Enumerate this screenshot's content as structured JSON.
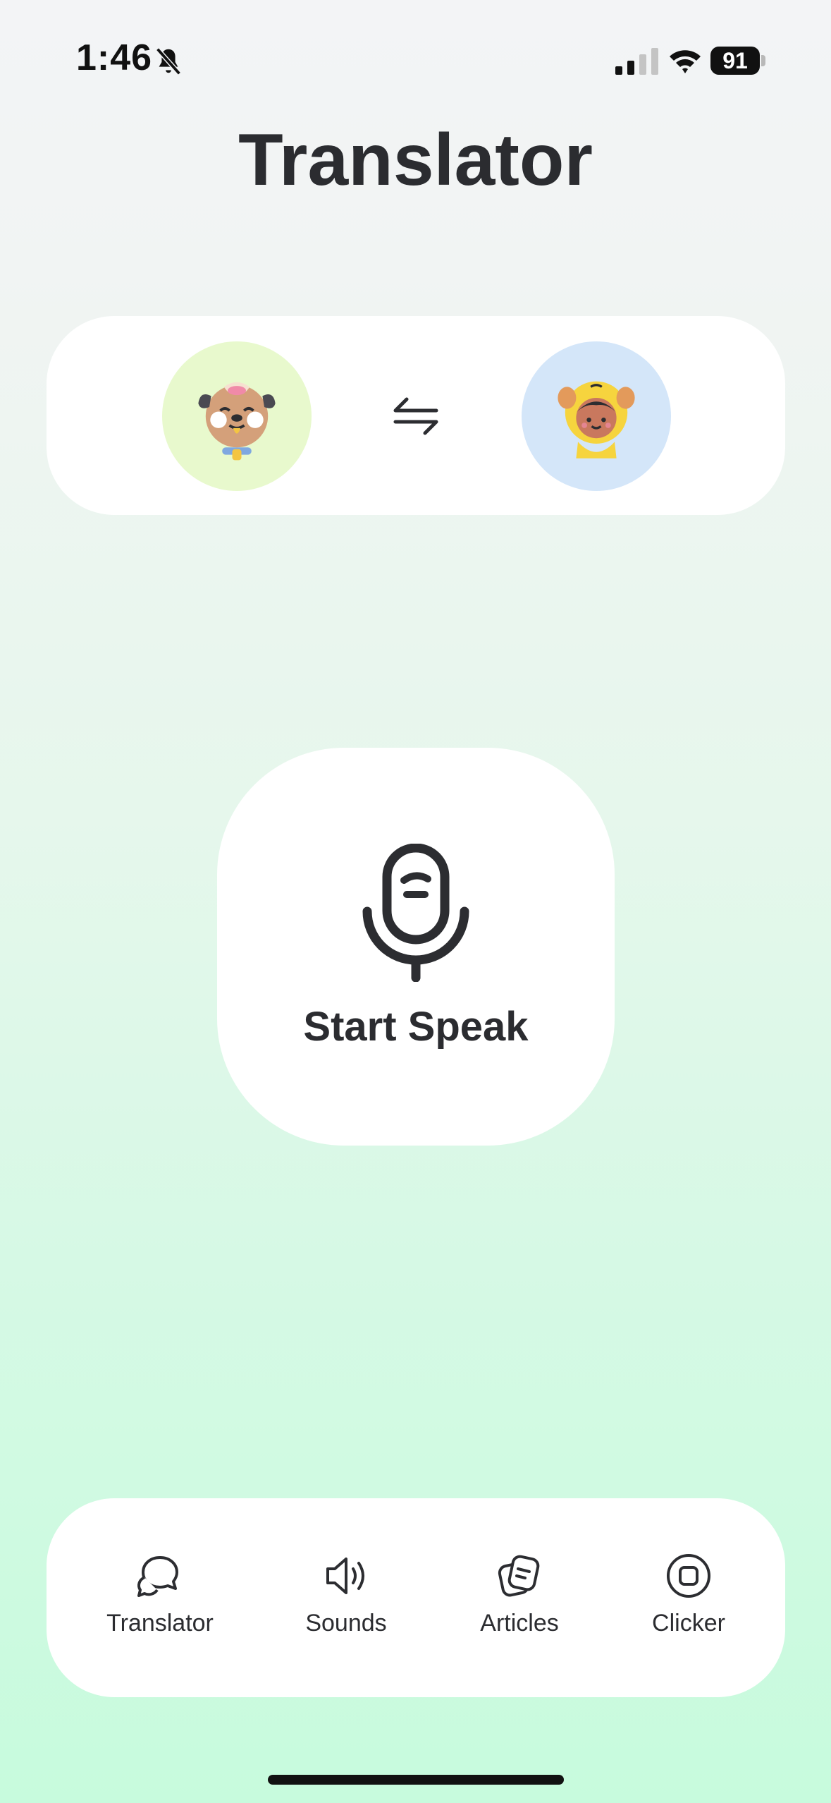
{
  "status_bar": {
    "time": "1:46",
    "battery": "91"
  },
  "header": {
    "title": "Translator"
  },
  "languages": {
    "from": "dog",
    "to": "human"
  },
  "speak": {
    "label": "Start Speak"
  },
  "nav": {
    "items": [
      {
        "label": "Translator",
        "icon": "chat-bubbles-icon"
      },
      {
        "label": "Sounds",
        "icon": "speaker-icon"
      },
      {
        "label": "Articles",
        "icon": "articles-icon"
      },
      {
        "label": "Clicker",
        "icon": "clicker-icon"
      }
    ]
  },
  "colors": {
    "accent_text": "#2b2c30",
    "dog_bg": "#e8f9cd",
    "human_bg": "#d4e6f9"
  }
}
